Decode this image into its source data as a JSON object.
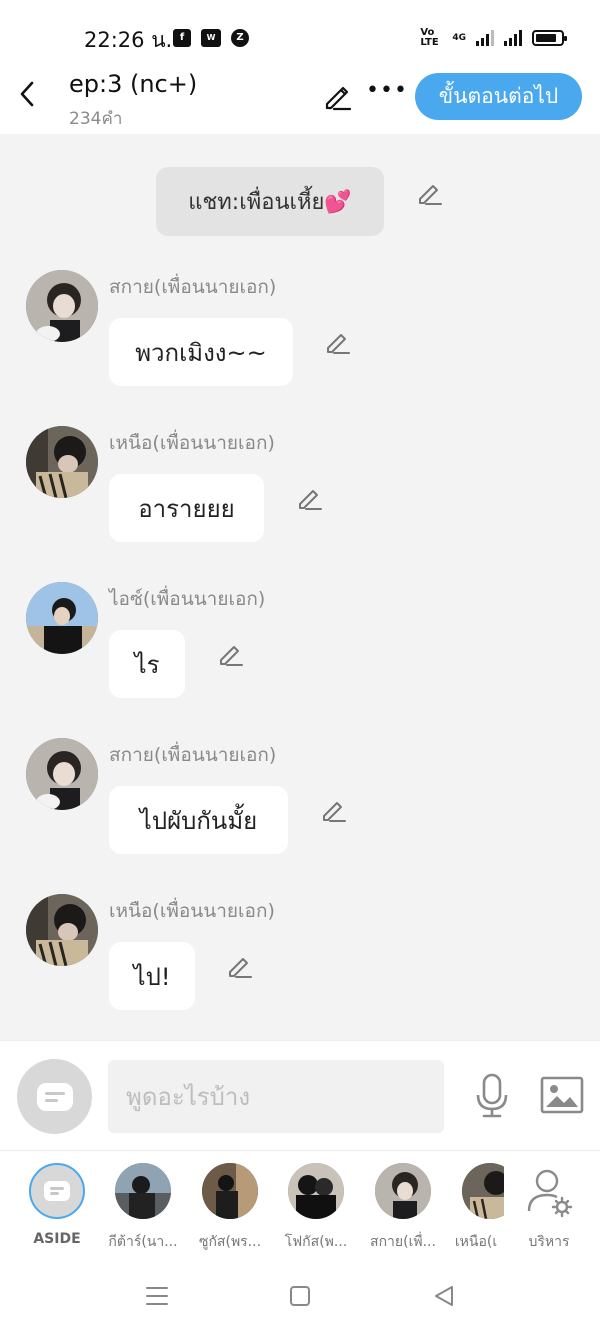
{
  "status_bar": {
    "time": "22:26 น.",
    "apps": [
      "f",
      "W",
      "Z"
    ],
    "net_left": "Vo LTE",
    "net_right": "4G",
    "battery_level": 0.85
  },
  "header": {
    "title": "ep:3 (nc+)",
    "word_count": "234คำ",
    "next_label": "ขั้นตอนต่อไป"
  },
  "scene": {
    "label": "แชท:เพื่อนเหี้ย💕"
  },
  "messages": [
    {
      "sender": "สกาย(เพื่อนนายเอก)",
      "text": "พวกเมิงง~~"
    },
    {
      "sender": "เหนือ(เพื่อนนายเอก)",
      "text": "อารายยย"
    },
    {
      "sender": "ไอซ์(เพื่อนนายเอก)",
      "text": "ไร"
    },
    {
      "sender": "สกาย(เพื่อนนายเอก)",
      "text": "ไปผับกันมั้ย"
    },
    {
      "sender": "เหนือ(เพื่อนนายเอก)",
      "text": "ไป!"
    }
  ],
  "composer": {
    "placeholder": "พูดอะไรบ้าง"
  },
  "characters": [
    {
      "label": "ASIDE"
    },
    {
      "label": "กีต้าร์(นา..."
    },
    {
      "label": "ซูกัส(พร..."
    },
    {
      "label": "โฟกัส(พ..."
    },
    {
      "label": "สกาย(เพื่..."
    },
    {
      "label": "เหนือ(เ"
    },
    {
      "label": "บริหาร"
    }
  ],
  "colors": {
    "accent": "#4aa8ef",
    "chat_bg": "#f3f3f3",
    "bubble_bg": "#ffffff",
    "scene_bg": "#e3e3e3"
  }
}
